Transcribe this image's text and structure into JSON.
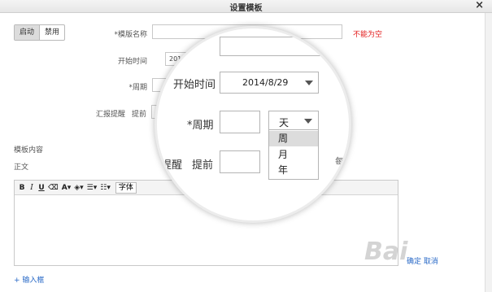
{
  "dialog": {
    "title": "设置模板",
    "close": "×"
  },
  "toggle": {
    "on": "启动",
    "off": "禁用"
  },
  "form": {
    "name_label": "*模版名称",
    "name_error": "不能为空",
    "start_label": "开始时间",
    "start_value": "2014/8/29",
    "cycle_label": "*周期",
    "remind_label": "汇报提醒",
    "ahead_label": "提前",
    "content_label": "模板内容",
    "body_label": "正文"
  },
  "editor": {
    "toolbar": [
      "B",
      "I",
      "U"
    ],
    "font_label": "字体"
  },
  "add_input": "+ 输入框",
  "magnifier": {
    "start_label": "开始时间",
    "start_value": "2014/8/29",
    "cycle_label": "*周期",
    "unit_selected": "天",
    "unit_options": [
      "周",
      "月",
      "年"
    ],
    "remind_label": "提醒",
    "ahead_label": "提前",
    "per_label": "每"
  },
  "bottom_right": "确定 取消",
  "watermark": "Bai"
}
